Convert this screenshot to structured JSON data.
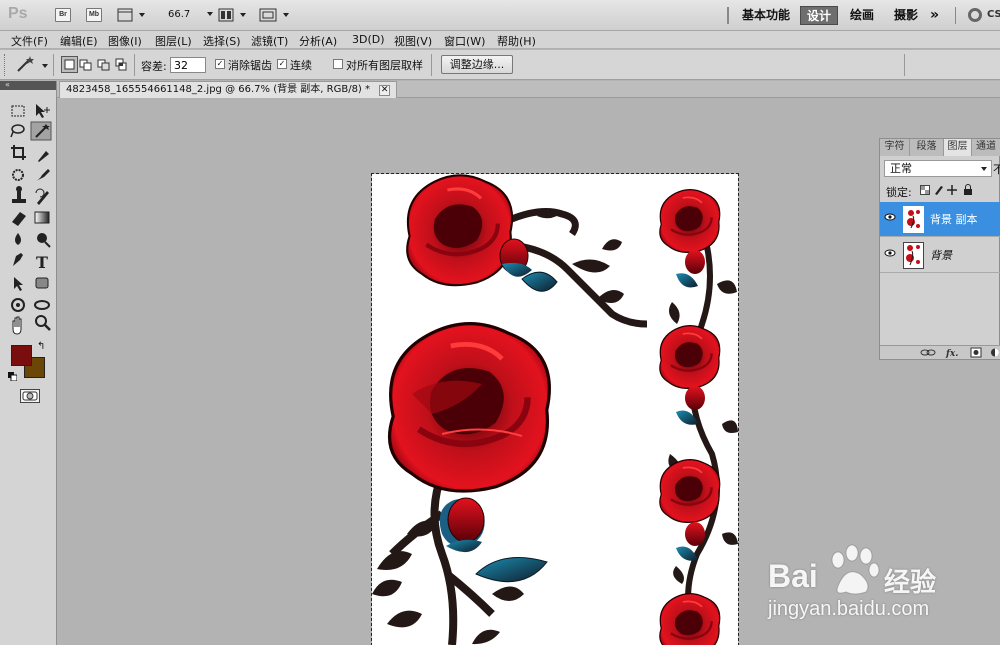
{
  "appbar": {
    "logo": "Ps",
    "bridge_label": "Br",
    "minibridge_label": "Mb",
    "zoom_value": "66.7",
    "workspaces": [
      "基本功能",
      "设计",
      "绘画",
      "摄影"
    ],
    "active_workspace": "设计",
    "more_label": "»",
    "cs_label": "CS"
  },
  "menu": [
    "文件(F)",
    "编辑(E)",
    "图像(I)",
    "图层(L)",
    "选择(S)",
    "滤镜(T)",
    "分析(A)",
    "3D(D)",
    "视图(V)",
    "窗口(W)",
    "帮助(H)"
  ],
  "options": {
    "tolerance_label": "容差:",
    "tolerance_value": "32",
    "antialias_label": "消除锯齿",
    "antialias_checked": true,
    "contiguous_label": "连续",
    "contiguous_checked": true,
    "sample_all_label": "对所有图层取样",
    "sample_all_checked": false,
    "refine_edge_label": "调整边缘..."
  },
  "document": {
    "tab_title": "4823458_165554661148_2.jpg @ 66.7% (背景 副本, RGB/8) *",
    "close_label": "✕"
  },
  "tools": {
    "foreground_color": "#7a0d0d",
    "background_color": "#6b4606"
  },
  "panel": {
    "tabs": [
      "字符",
      "段落",
      "图层",
      "通道"
    ],
    "active_tab": "图层",
    "blend_mode": "正常",
    "opacity_abbrev": "不",
    "lock_label": "锁定:",
    "layers": [
      {
        "name": "背景 副本",
        "selected": true
      },
      {
        "name": "背景",
        "selected": false,
        "italic": true
      }
    ],
    "footer_icons": [
      "link-icon",
      "fx-icon",
      "mask-icon",
      "adjustment-icon"
    ],
    "fx_label": "fx."
  },
  "watermark": {
    "brand": "Bai",
    "brand_suffix": "经验",
    "url": "jingyan.baidu.com"
  },
  "colors": {
    "rose_red": "#c0101a",
    "rose_dark": "#4a0006",
    "leaf_blue": "#1b8fb4",
    "vine": "#231815",
    "selection_blue": "#3a8fe0"
  }
}
